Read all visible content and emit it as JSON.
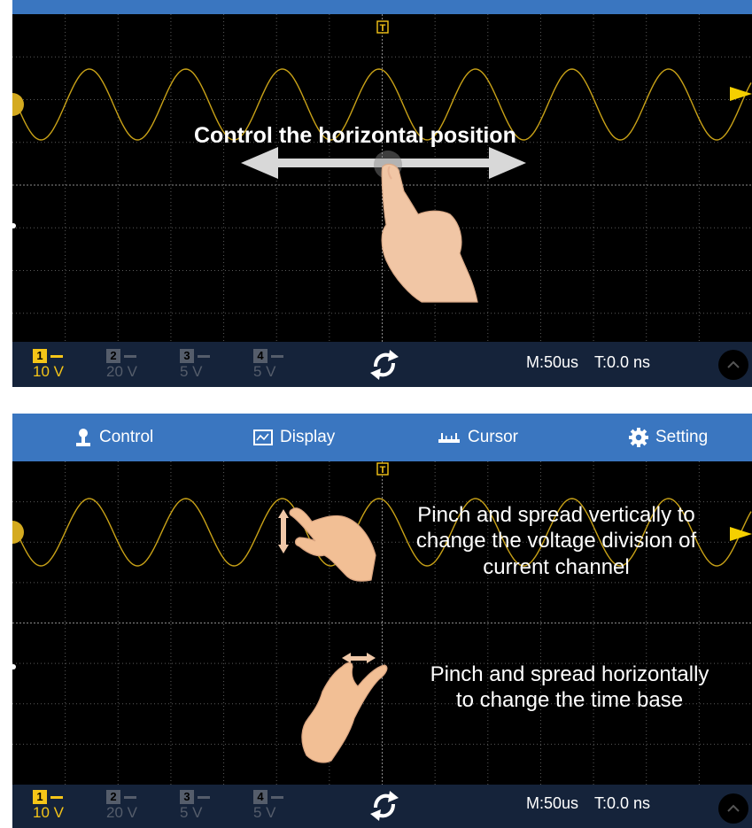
{
  "menu": {
    "control": "Control",
    "display": "Display",
    "cursor": "Cursor",
    "setting": "Setting"
  },
  "annotations": {
    "horizontal": "Control the horizontal position",
    "vertical": [
      "Pinch and spread vertically to",
      "change the voltage division of",
      "current channel"
    ],
    "timebase": [
      "Pinch and spread horizontally",
      "to change the time base"
    ]
  },
  "channels": [
    {
      "num": "1",
      "volt": "10 V",
      "active": true
    },
    {
      "num": "2",
      "volt": "20 V",
      "active": false
    },
    {
      "num": "3",
      "volt": "5 V",
      "active": false
    },
    {
      "num": "4",
      "volt": "5 V",
      "active": false
    }
  ],
  "status": {
    "timebase": "M:50us",
    "trigger_time": "T:0.0 ns"
  },
  "trigger_marker": "T",
  "colors": {
    "menubar": "#3a76c0",
    "bottombar": "#15233a",
    "ch1": "#f5c518",
    "trace": "#c9a217",
    "grid": "#5a5a5a",
    "inactive": "#555d6b"
  },
  "icons": [
    "control-person-icon",
    "display-waveform-icon",
    "cursor-ruler-icon",
    "setting-gear-icon",
    "refresh-icon",
    "expand-up-icon",
    "trigger-t-icon",
    "trigger-level-arrow-icon",
    "channel-marker-icon",
    "hand-drag-icon",
    "hand-pinch-vertical-icon",
    "hand-pinch-horizontal-icon"
  ]
}
